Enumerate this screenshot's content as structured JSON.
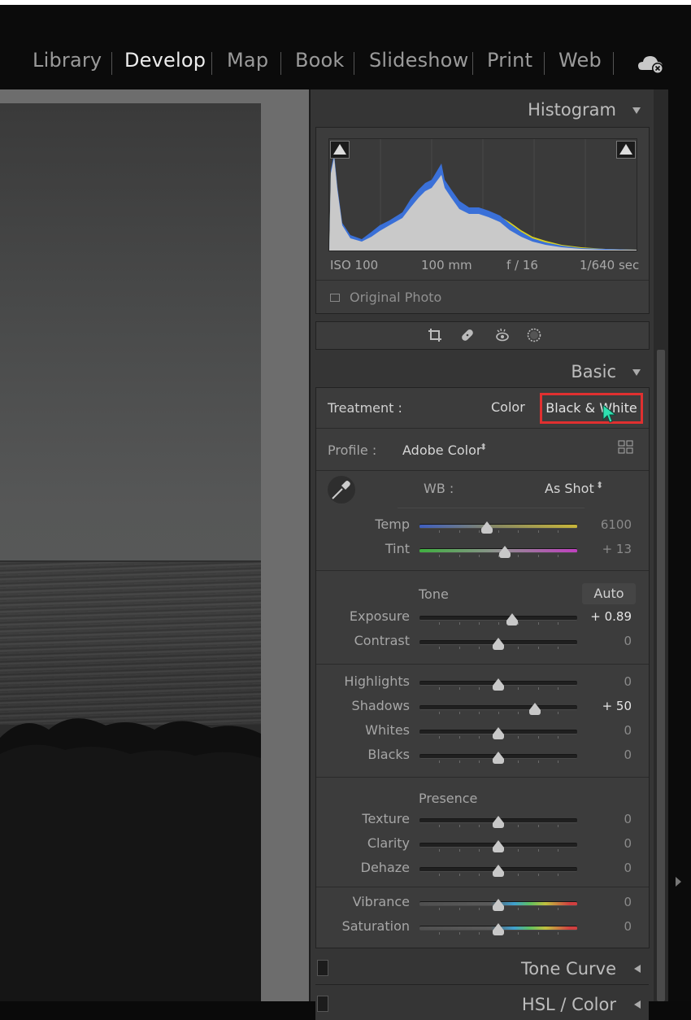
{
  "modules": [
    "Library",
    "Develop",
    "Map",
    "Book",
    "Slideshow",
    "Print",
    "Web"
  ],
  "active_module": "Develop",
  "histogram": {
    "title": "Histogram",
    "exif": {
      "iso": "ISO 100",
      "focal": "100 mm",
      "aperture": "f / 16",
      "shutter": "1/640 sec"
    },
    "original_photo_label": "Original Photo"
  },
  "basic": {
    "title": "Basic",
    "treatment_label": "Treatment :",
    "color_label": "Color",
    "bw_label": "Black & White",
    "profile_label": "Profile :",
    "profile_value": "Adobe Color",
    "wb_label": "WB :",
    "wb_value": "As Shot",
    "tone_label": "Tone",
    "auto_label": "Auto",
    "presence_label": "Presence",
    "sliders": {
      "temp": {
        "label": "Temp",
        "value": "6100",
        "pos": 0.43
      },
      "tint": {
        "label": "Tint",
        "value": "+ 13",
        "pos": 0.54
      },
      "exposure": {
        "label": "Exposure",
        "value": "+ 0.89",
        "pos": 0.59
      },
      "contrast": {
        "label": "Contrast",
        "value": "0",
        "pos": 0.5
      },
      "highlights": {
        "label": "Highlights",
        "value": "0",
        "pos": 0.5
      },
      "shadows": {
        "label": "Shadows",
        "value": "+ 50",
        "pos": 0.73
      },
      "whites": {
        "label": "Whites",
        "value": "0",
        "pos": 0.5
      },
      "blacks": {
        "label": "Blacks",
        "value": "0",
        "pos": 0.5
      },
      "texture": {
        "label": "Texture",
        "value": "0",
        "pos": 0.5
      },
      "clarity": {
        "label": "Clarity",
        "value": "0",
        "pos": 0.5
      },
      "dehaze": {
        "label": "Dehaze",
        "value": "0",
        "pos": 0.5
      },
      "vibrance": {
        "label": "Vibrance",
        "value": "0",
        "pos": 0.5
      },
      "saturation": {
        "label": "Saturation",
        "value": "0",
        "pos": 0.5
      }
    }
  },
  "tone_curve_title": "Tone Curve",
  "hsl_title": "HSL / Color",
  "colors": {
    "highlight_border": "#e03030",
    "cursor": "#2fe0b0"
  }
}
